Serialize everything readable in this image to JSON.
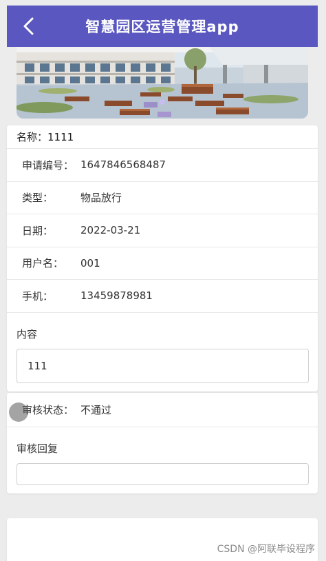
{
  "header": {
    "title": "智慧园区运营管理app",
    "background_color": "#5a58c0"
  },
  "detail": {
    "name_label": "名称：",
    "name_value": "1111",
    "rows": [
      {
        "label": "申请编号：",
        "value": "1647846568487"
      },
      {
        "label": "类型：",
        "value": "物品放行"
      },
      {
        "label": "日期：",
        "value": "2022-03-21"
      },
      {
        "label": "用户名：",
        "value": "001"
      },
      {
        "label": "手机：",
        "value": "13459878981"
      }
    ],
    "content_label": "内容",
    "content_value": "111"
  },
  "review": {
    "status_label": "审核状态：",
    "status_value": "不通过",
    "reply_label": "审核回复",
    "reply_value": ""
  },
  "watermark": "CSDN @阿联毕设程序"
}
